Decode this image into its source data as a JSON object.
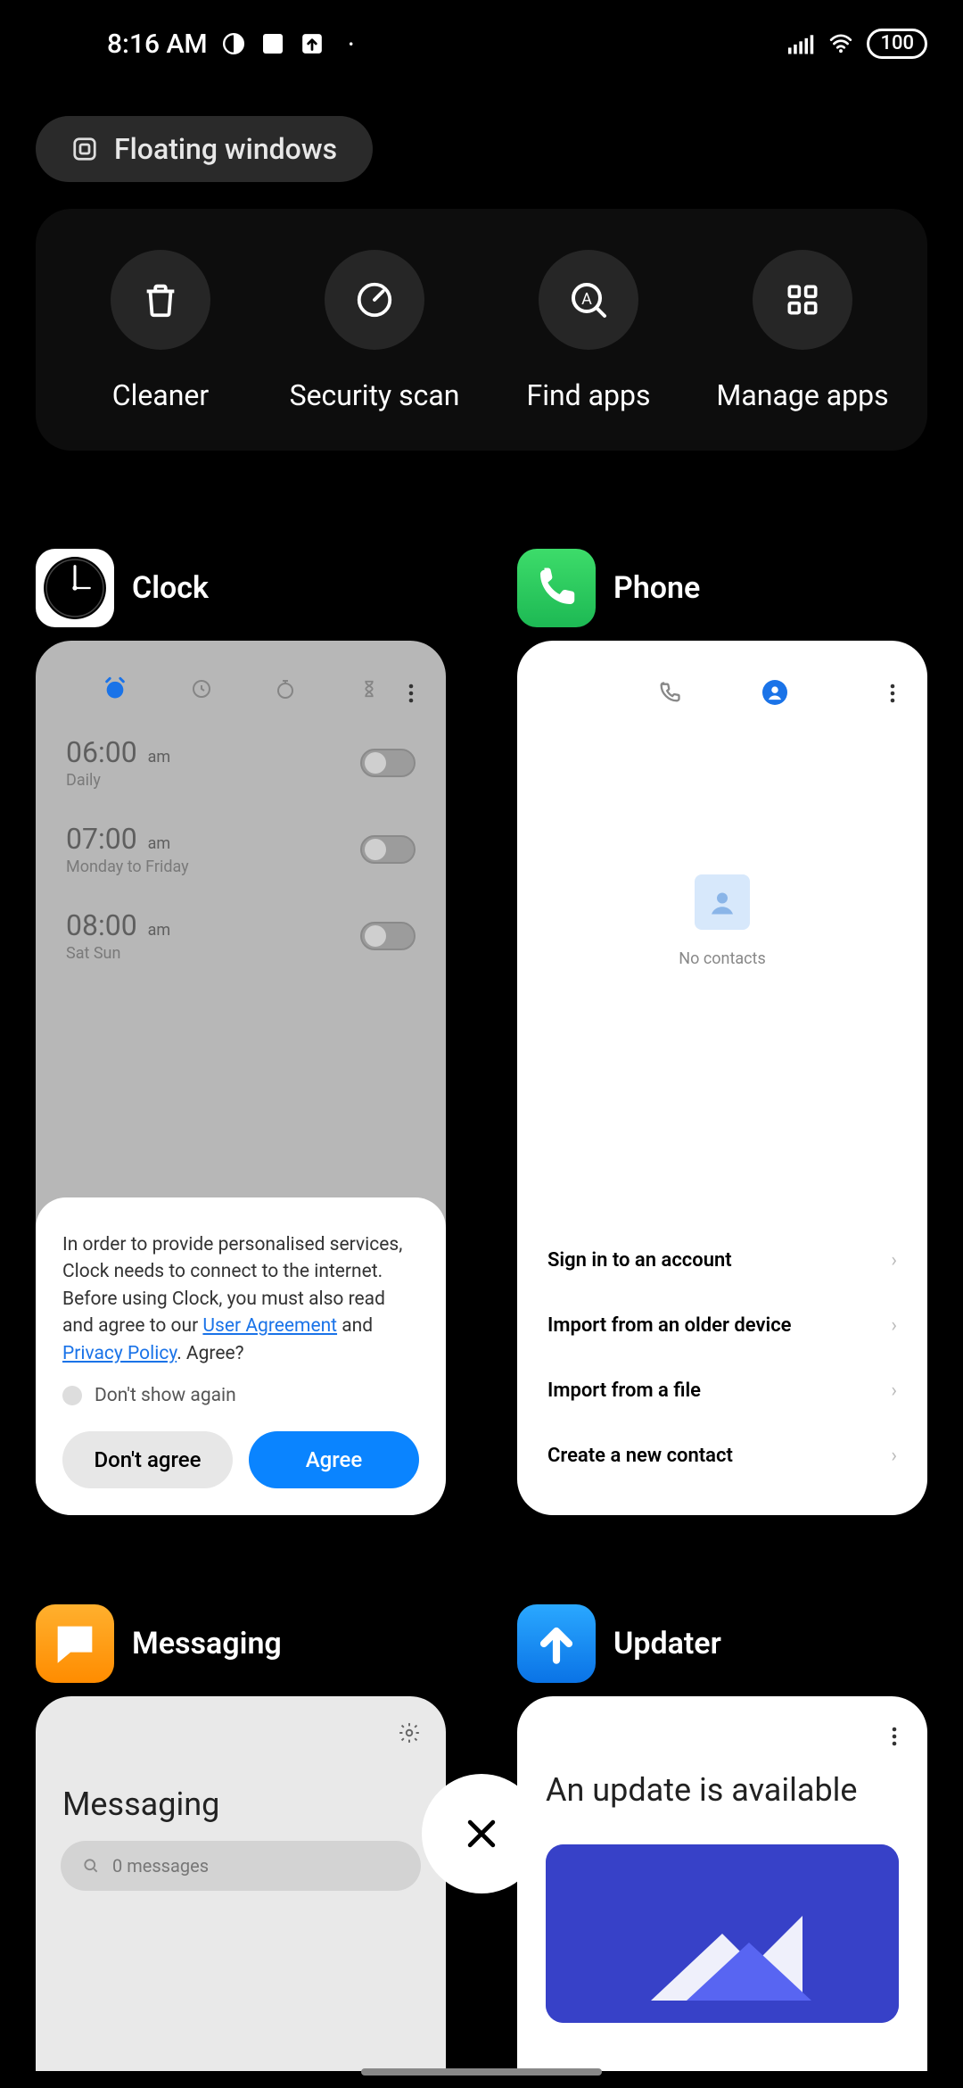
{
  "status": {
    "time": "8:16 AM",
    "battery": "100"
  },
  "floating_label": "Floating windows",
  "tools": {
    "cleaner": "Cleaner",
    "security": "Security scan",
    "find": "Find apps",
    "manage": "Manage apps"
  },
  "clock": {
    "title": "Clock",
    "alarms": [
      {
        "time": "06:00",
        "ampm": "am",
        "sub": "Daily"
      },
      {
        "time": "07:00",
        "ampm": "am",
        "sub": "Monday to Friday"
      },
      {
        "time": "08:00",
        "ampm": "am",
        "sub": "Sat Sun"
      }
    ],
    "dialog": {
      "text_pre": "In order to provide personalised services, Clock needs to connect to the internet. Before using Clock, you must also read and agree to our ",
      "link1": "User Agreement",
      "mid": " and ",
      "link2": "Privacy Policy",
      "text_post": ". Agree?",
      "dont_show": "Don't show again",
      "dont_agree": "Don't agree",
      "agree": "Agree"
    }
  },
  "phone": {
    "title": "Phone",
    "empty": "No contacts",
    "items": [
      "Sign in to an account",
      "Import from an older device",
      "Import from a file",
      "Create a new contact"
    ]
  },
  "messaging": {
    "title": "Messaging",
    "heading": "Messaging",
    "search_placeholder": "0 messages"
  },
  "updater": {
    "title": "Updater",
    "heading": "An update is available"
  }
}
